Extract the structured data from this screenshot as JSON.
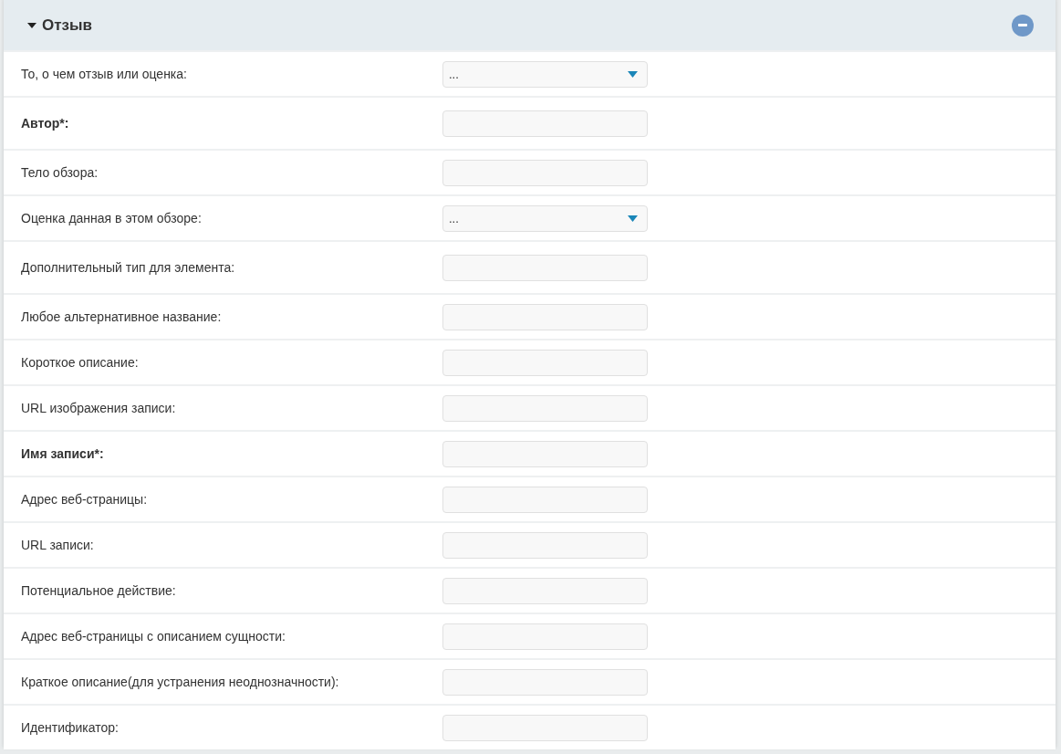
{
  "panel": {
    "title": "Отзыв",
    "expanded": true
  },
  "fields": [
    {
      "kind": "select",
      "label": "То, о чем отзыв или оценка:",
      "value": "...",
      "required": false
    },
    {
      "kind": "text",
      "label": "Автор*:",
      "required": true
    },
    {
      "kind": "text",
      "label": "Тело обзора:",
      "required": false
    },
    {
      "kind": "select",
      "label": "Оценка данная в этом обзоре:",
      "value": "...",
      "required": false
    },
    {
      "kind": "text",
      "label": "Дополнительный тип для элемента:",
      "required": false
    },
    {
      "kind": "text",
      "label": "Любое альтернативное название:",
      "required": false
    },
    {
      "kind": "text",
      "label": "Короткое описание:",
      "required": false
    },
    {
      "kind": "text",
      "label": "URL изображения записи:",
      "required": false
    },
    {
      "kind": "text",
      "label": "Имя записи*:",
      "required": true
    },
    {
      "kind": "text",
      "label": "Адрес веб-страницы:",
      "required": false
    },
    {
      "kind": "text",
      "label": "URL записи:",
      "required": false
    },
    {
      "kind": "text",
      "label": "Потенциальное действие:",
      "required": false
    },
    {
      "kind": "text",
      "label": "Адрес веб-страницы с описанием сущности:",
      "required": false
    },
    {
      "kind": "text",
      "label": "Краткое описание(для устранения неоднозначности):",
      "required": false
    },
    {
      "kind": "text",
      "label": "Идентификатор:",
      "required": false
    }
  ]
}
